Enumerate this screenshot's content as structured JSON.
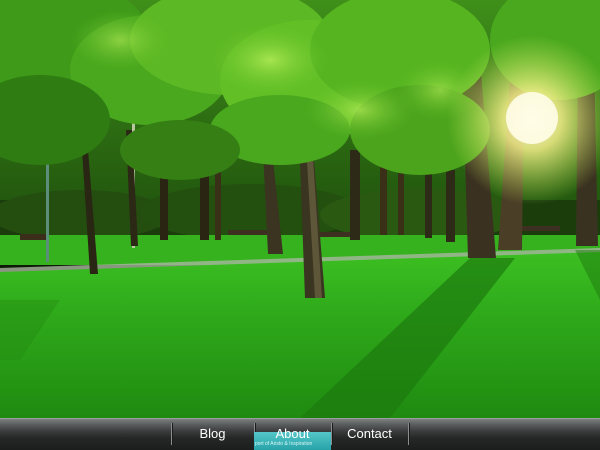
{
  "nav": {
    "items": [
      {
        "label": "Blog",
        "active": false
      },
      {
        "label": "About",
        "active": true
      },
      {
        "label": "Contact",
        "active": false
      }
    ],
    "active_caption": "port of Aristo & Inspiration"
  },
  "colors": {
    "nav_active": "#2fb0b5",
    "nav_bar": "#2a2c2c",
    "grass": "#2fae1a",
    "canopy": "#4fb822",
    "sun": "#fff6b0"
  }
}
